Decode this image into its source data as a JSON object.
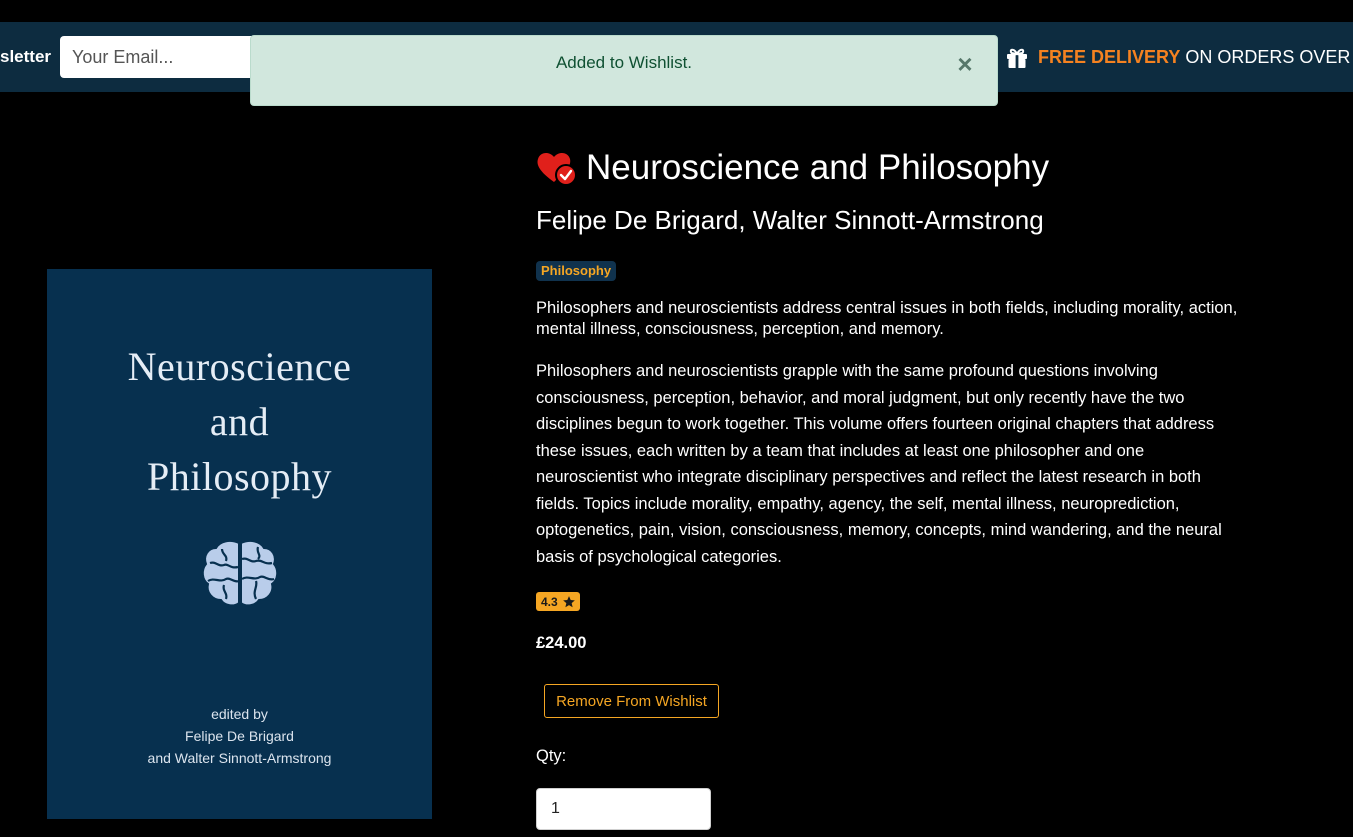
{
  "header": {
    "newsletter_label": "sletter",
    "email_placeholder": "Your Email...",
    "delivery_highlight": "FREE DELIVERY",
    "delivery_text": "ON ORDERS OVER £"
  },
  "toast": {
    "message": "Added to Wishlist.",
    "close_label": "×",
    "color": "#d1e7dd"
  },
  "cover": {
    "title_lines": [
      "Neuroscience",
      "and",
      "Philosophy"
    ],
    "credit_lines": [
      "edited by",
      "Felipe De Brigard",
      "and Walter Sinnott-Armstrong"
    ],
    "background": "#07304f",
    "icon": "brain-puzzle-icon"
  },
  "product": {
    "title": "Neuroscience and Philosophy",
    "authors": "Felipe De Brigard, Walter Sinnott-Armstrong",
    "category": "Philosophy",
    "summary": "Philosophers and neuroscientists address central issues in both fields, including morality, action, mental illness, consciousness, perception, and memory.",
    "description": "Philosophers and neuroscientists grapple with the same profound questions involving consciousness, perception, behavior, and moral judgment, but only recently have the two disciplines begun to work together. This volume offers fourteen original chapters that address these issues, each written by a team that includes at least one philosopher and one neuroscientist who integrate disciplinary perspectives and reflect the latest research in both fields. Topics include morality, empathy, agency, the self, mental illness, neuroprediction, optogenetics, pain, vision, consciousness, memory, concepts, mind wandering, and the neural basis of psychological categories.",
    "rating": "4.3",
    "price": "£24.00",
    "wishlist_button": "Remove From Wishlist",
    "qty_label": "Qty:",
    "qty_value": "1"
  },
  "colors": {
    "accent": "#f5a623",
    "delivery_accent": "#f58220",
    "header_bg": "#0d2c40",
    "heart": "#e0201b"
  },
  "icons": [
    "gift-icon",
    "heart-check-icon",
    "star-icon",
    "close-icon",
    "brain-puzzle-icon"
  ]
}
